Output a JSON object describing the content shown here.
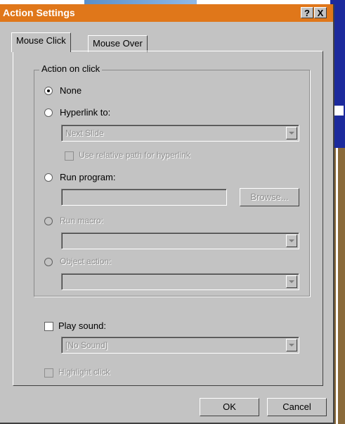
{
  "dialog": {
    "title": "Action Settings",
    "help_label": "?",
    "close_label": "X"
  },
  "tabs": [
    {
      "label": "Mouse Click",
      "active": true
    },
    {
      "label": "Mouse Over",
      "active": false
    }
  ],
  "group": {
    "label": "Action on click",
    "options": {
      "none": {
        "label": "None",
        "selected": true
      },
      "hyperlink": {
        "label": "Hyperlink to:",
        "value": "Next Slide",
        "relative_path_label": "Use relative path for hyperlink"
      },
      "run_program": {
        "label": "Run program:",
        "value": "",
        "browse_label": "Browse..."
      },
      "run_macro": {
        "label": "Run macro:",
        "value": ""
      },
      "object_action": {
        "label": "Object action:",
        "value": ""
      }
    }
  },
  "play_sound": {
    "label": "Play sound:",
    "value": "[No Sound]",
    "checked": false
  },
  "highlight_click": {
    "label": "Highlight click",
    "checked": false
  },
  "buttons": {
    "ok": "OK",
    "cancel": "Cancel"
  }
}
